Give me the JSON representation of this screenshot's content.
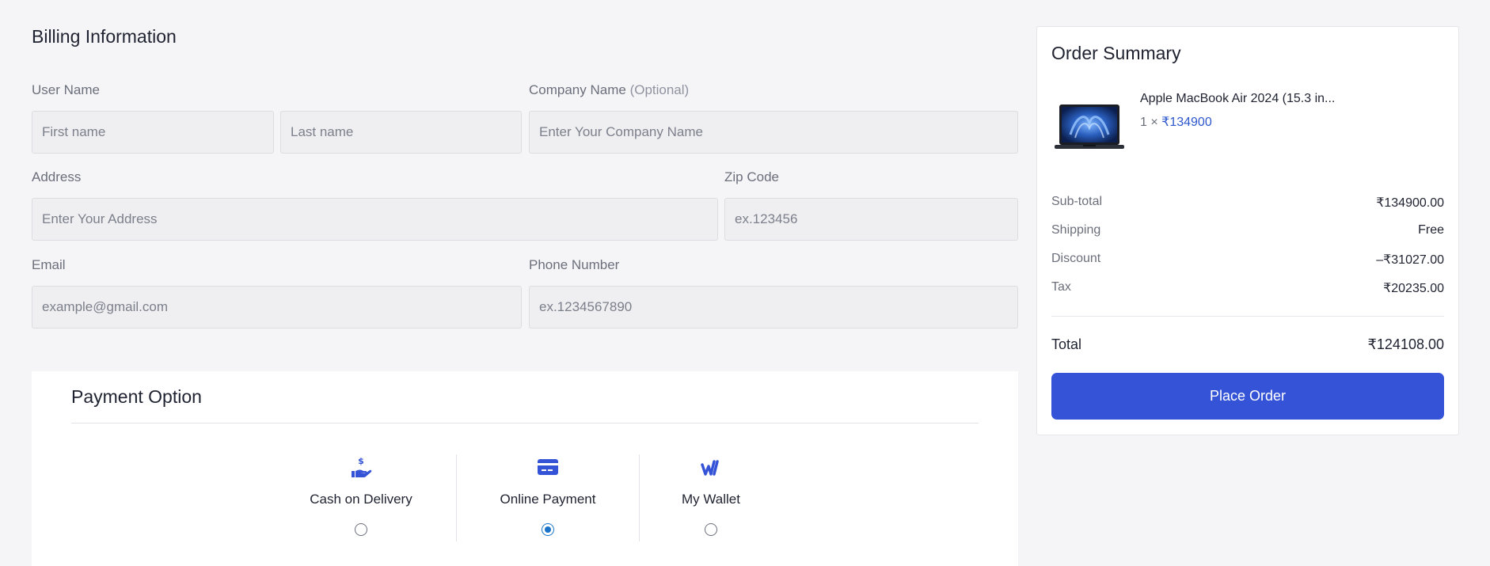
{
  "billing": {
    "title": "Billing Information",
    "user_name_label": "User Name",
    "first_name_placeholder": "First name",
    "last_name_placeholder": "Last name",
    "company_label": "Company Name",
    "company_optional": "(Optional)",
    "company_placeholder": "Enter Your Company Name",
    "address_label": "Address",
    "address_placeholder": "Enter Your Address",
    "zip_label": "Zip Code",
    "zip_placeholder": "ex.123456",
    "email_label": "Email",
    "email_placeholder": "example@gmail.com",
    "phone_label": "Phone Number",
    "phone_placeholder": "ex.1234567890"
  },
  "payment": {
    "title": "Payment Option",
    "options": [
      {
        "label": "Cash on Delivery",
        "icon": "cash-hand-icon",
        "selected": false
      },
      {
        "label": "Online Payment",
        "icon": "credit-card-icon",
        "selected": true
      },
      {
        "label": "My Wallet",
        "icon": "wallet-logo-icon",
        "selected": false
      }
    ]
  },
  "summary": {
    "title": "Order Summary",
    "product": {
      "name": "Apple MacBook Air 2024 (15.3 in...",
      "qty": "1 ×",
      "price": "₹134900",
      "image": "laptop-image"
    },
    "rows": [
      {
        "label": "Sub-total",
        "value": "₹134900.00"
      },
      {
        "label": "Shipping",
        "value": "Free"
      },
      {
        "label": "Discount",
        "value": "–₹31027.00"
      },
      {
        "label": "Tax",
        "value": "₹20235.00"
      }
    ],
    "total_label": "Total",
    "total_value": "₹124108.00",
    "place_order_label": "Place Order"
  },
  "colors": {
    "accent": "#3553d6",
    "radio_selected": "#1a73c8",
    "price": "#2f58cd",
    "background": "#f5f5f7"
  }
}
